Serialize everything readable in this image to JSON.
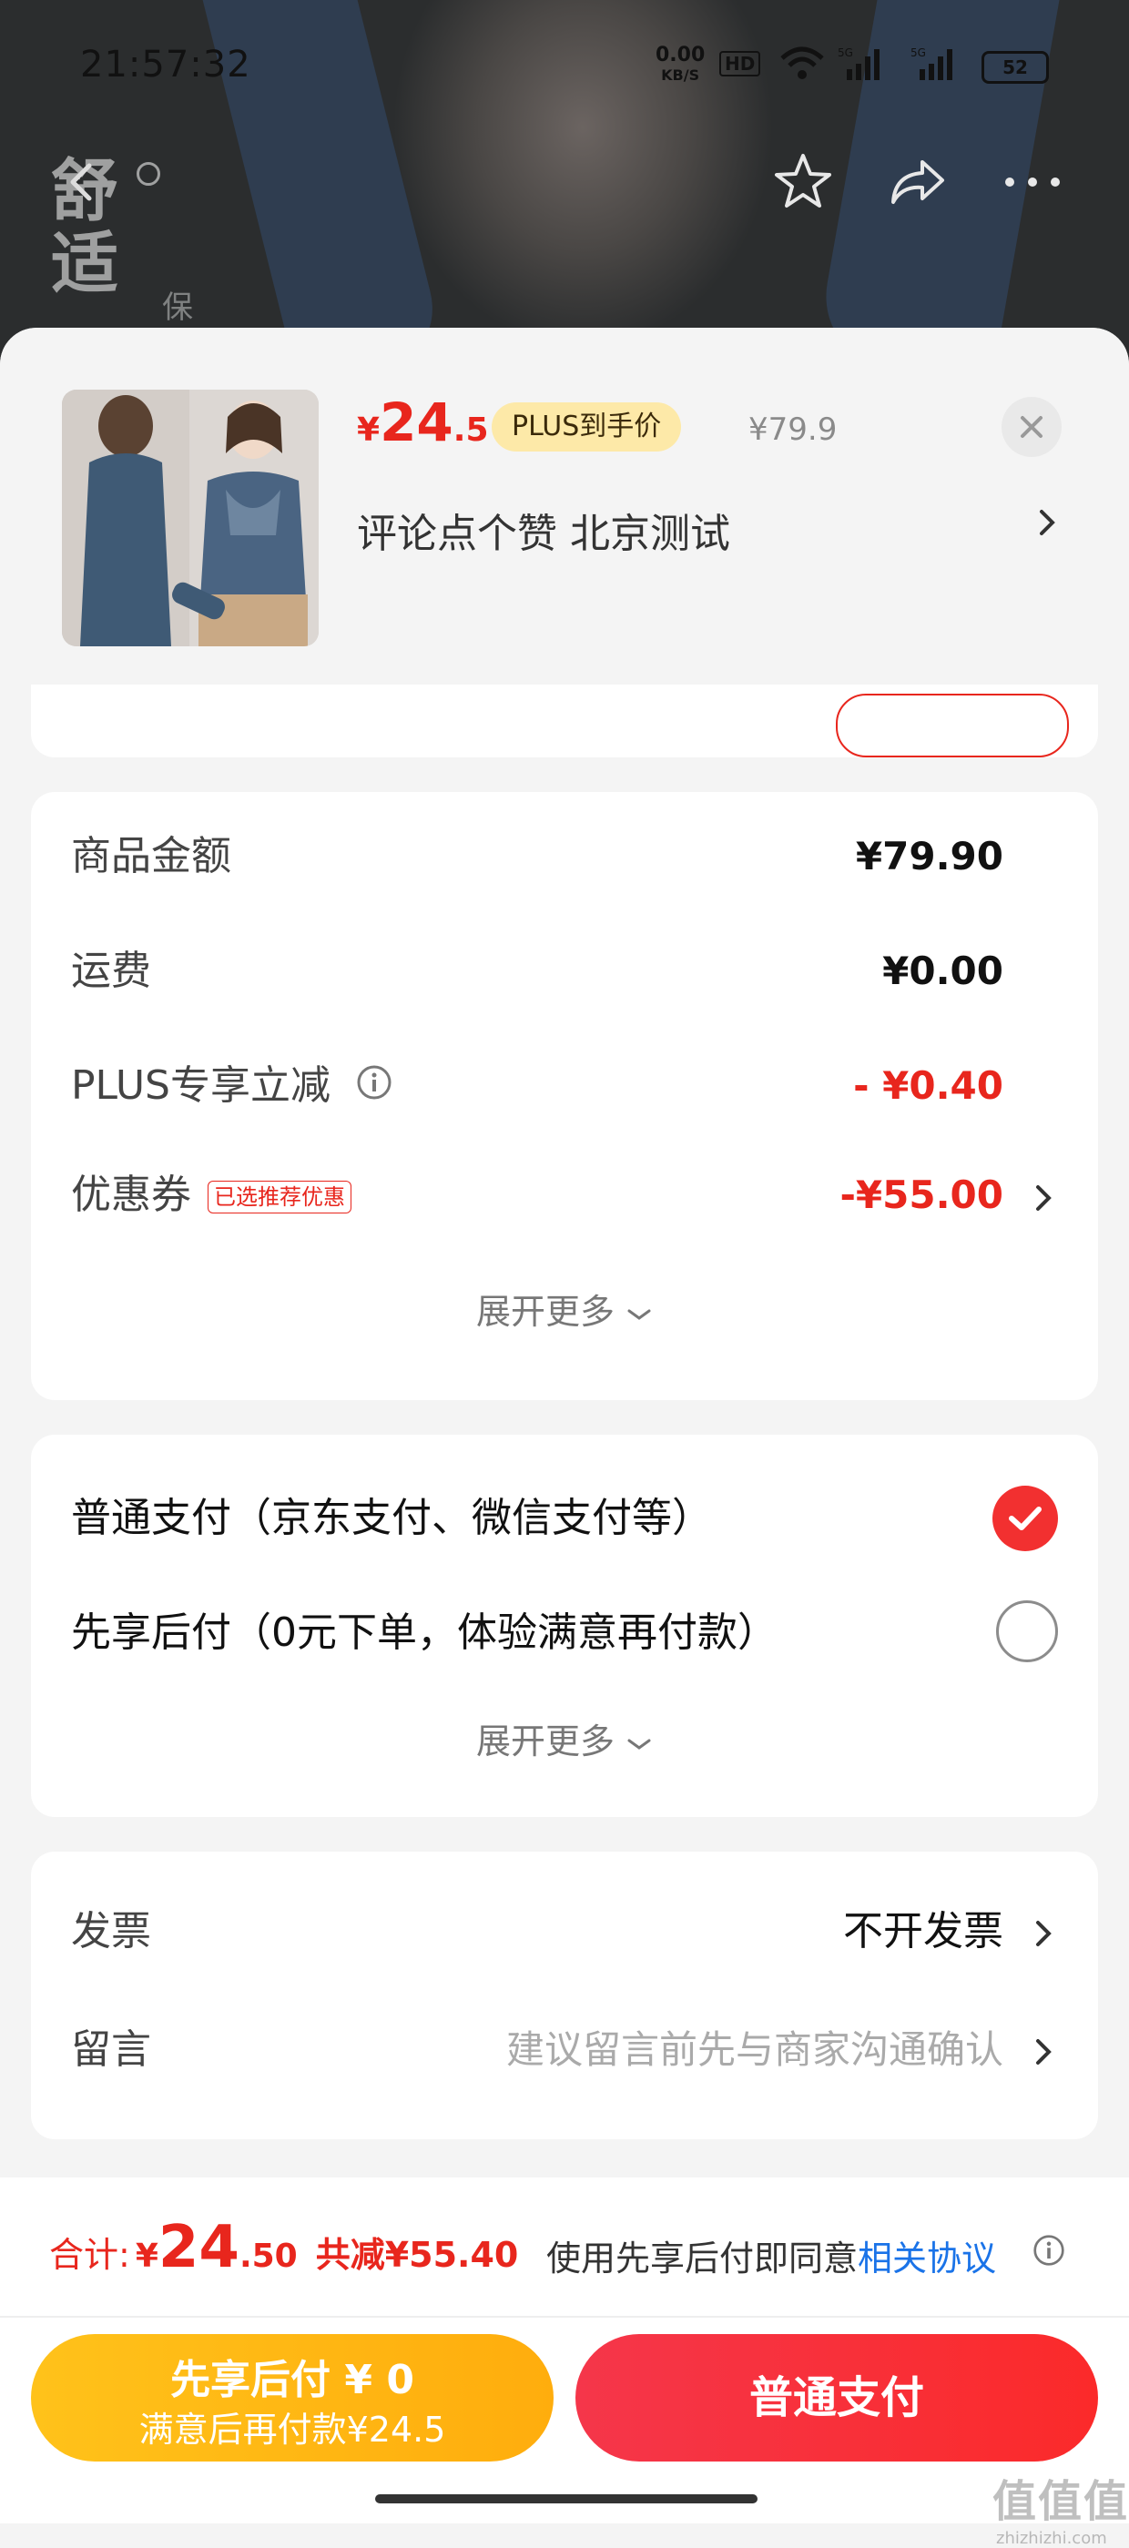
{
  "status_bar": {
    "time": "21:57:32",
    "net_speed_value": "0.00",
    "net_speed_unit": "KB/S",
    "hd_badge": "HD",
    "battery": "52"
  },
  "background": {
    "text_line1": "舒",
    "text_line2": "适",
    "text_small": "保"
  },
  "product": {
    "price_symbol": "¥",
    "price_int": "24",
    "price_dec": ".5",
    "plus_tag": "PLUS到手价",
    "original_price": "¥79.9",
    "spec": "评论点个赞  北京测试"
  },
  "amounts": {
    "rows": [
      {
        "label": "商品金额",
        "value": "¥79.90"
      },
      {
        "label": "运费",
        "value": "¥0.00"
      },
      {
        "label": "PLUS专享立减",
        "value": "- ¥0.40"
      },
      {
        "label": "优惠券",
        "tag": "已选推荐优惠",
        "value": "-¥55.00"
      }
    ],
    "expand_label": "展开更多"
  },
  "payment": {
    "options": [
      {
        "label": "普通支付（京东支付、微信支付等）",
        "selected": true
      },
      {
        "label": "先享后付（0元下单，体验满意再付款）",
        "selected": false
      }
    ],
    "expand_label": "展开更多"
  },
  "extras": {
    "invoice_label": "发票",
    "invoice_value": "不开发票",
    "message_label": "留言",
    "message_placeholder": "建议留言前先与商家沟通确认"
  },
  "summary": {
    "total_label": "合计:",
    "yen": "¥",
    "total_int": "24",
    "total_dec": ".50",
    "saved": "共减¥55.40",
    "agree_text": "使用先享后付即同意",
    "agree_link": "相关协议"
  },
  "buttons": {
    "pay_later_line1": "先享后付 ¥ 0",
    "pay_later_line2": "满意后再付款¥24.5",
    "pay_now": "普通支付"
  },
  "watermark": {
    "big": "值值值",
    "small": "zhizhizhi.com"
  },
  "colors": {
    "accent_red": "#e8261d",
    "plus_gold": "#fde9a8",
    "pay_later_yellow": "#ffc21a",
    "link_blue": "#1a73e8"
  },
  "icons": [
    "back-icon",
    "star-icon",
    "share-icon",
    "more-icon",
    "close-icon",
    "chevron-right-icon",
    "info-icon",
    "chevron-down-icon",
    "check-icon",
    "wifi-icon",
    "signal-icon"
  ]
}
